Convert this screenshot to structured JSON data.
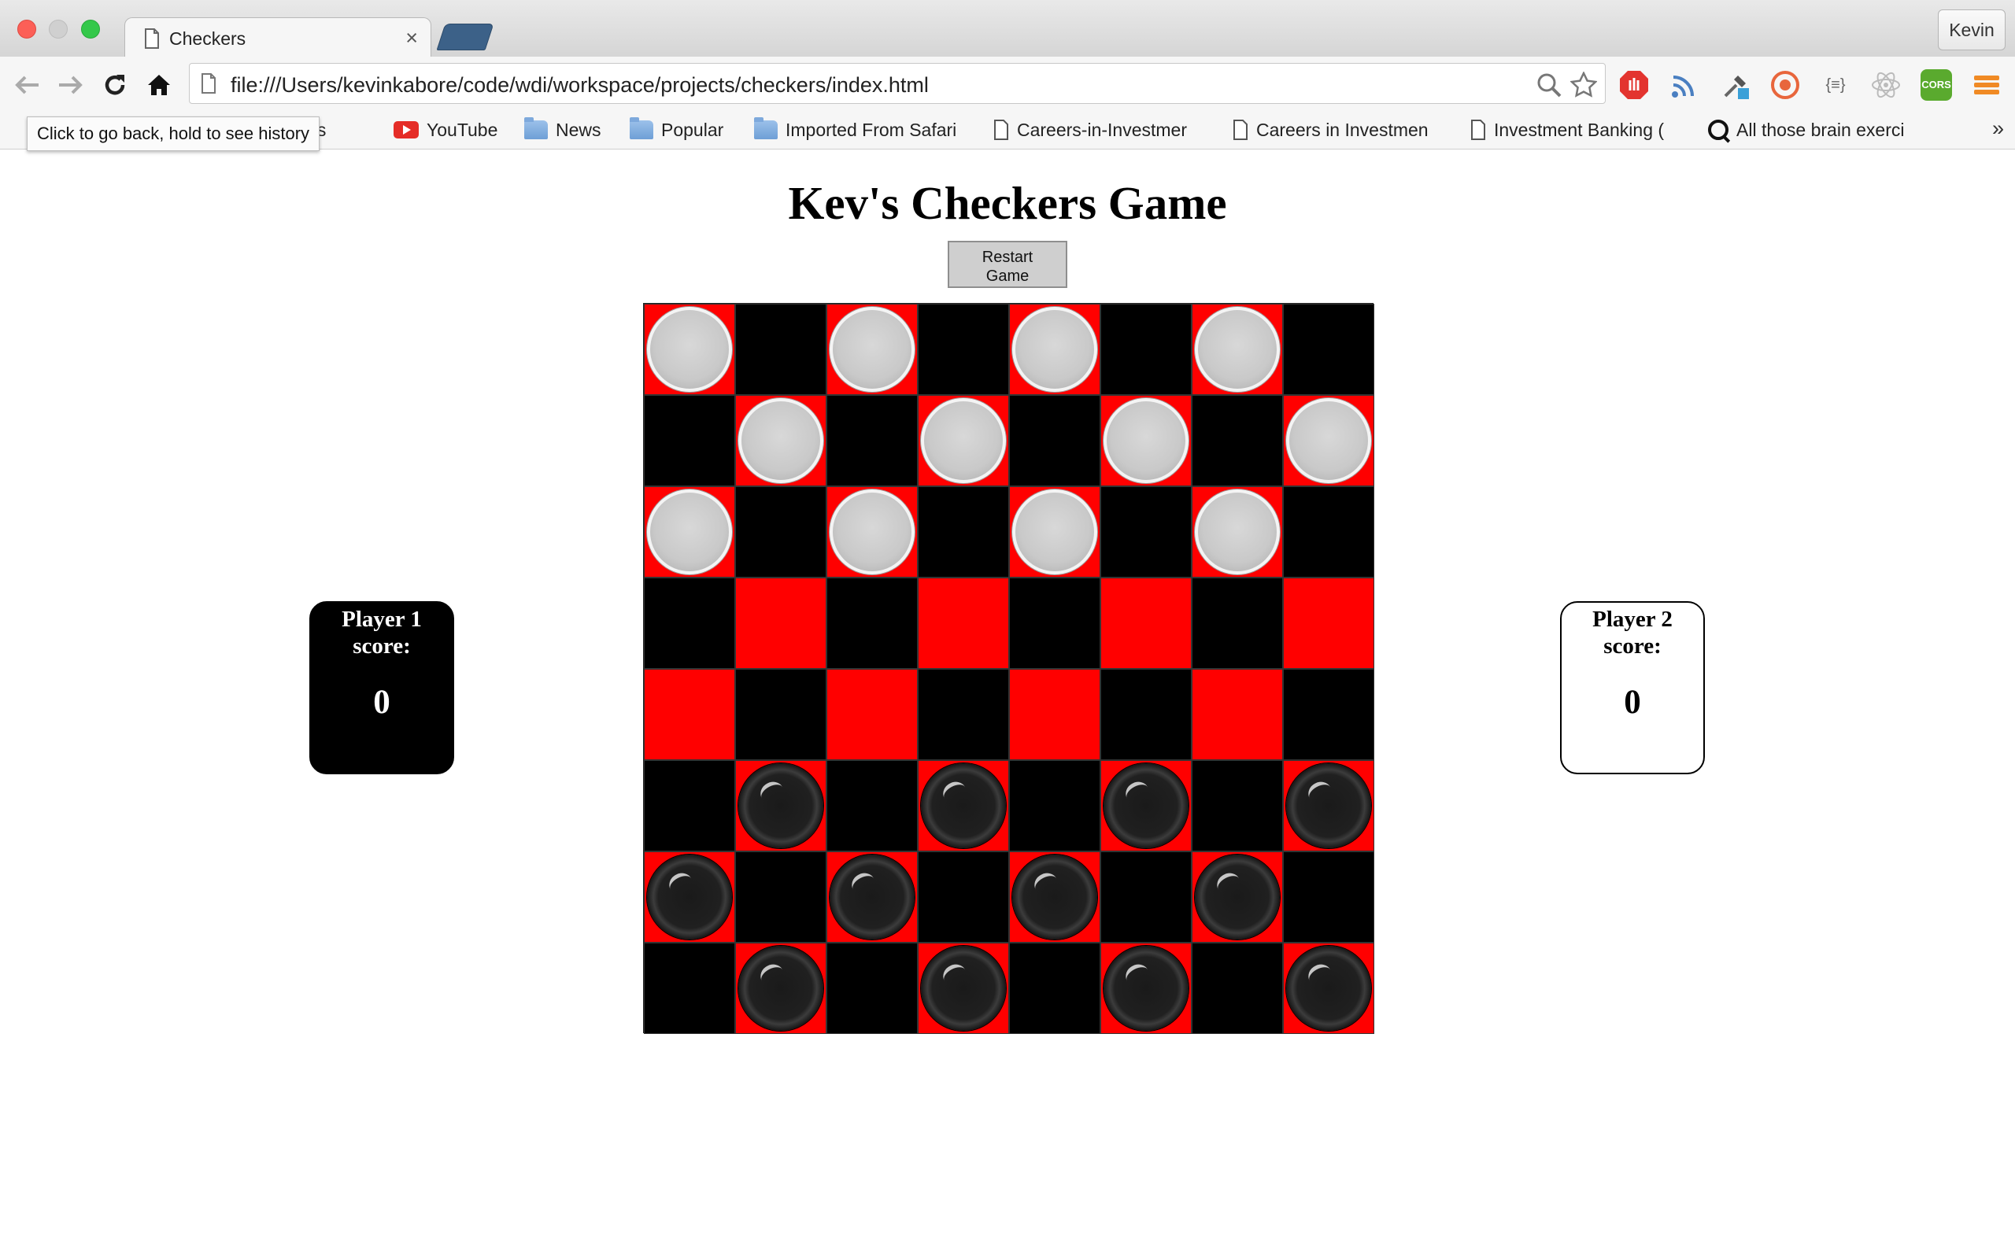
{
  "browser": {
    "tab_title": "Checkers",
    "tab_close": "×",
    "profile": "Kevin",
    "url": "file:///Users/kevinkabore/code/wdi/workspace/projects/checkers/index.html",
    "tooltip": "Click to go back, hold to see history",
    "bookmarks": {
      "apps": "Apps",
      "youtube": "YouTube",
      "news": "News",
      "popular": "Popular",
      "imported": "Imported From Safari",
      "careers1": "Careers-in-Investmer",
      "careers2": "Careers in Investmen",
      "banking": "Investment Banking (",
      "brain": "All those brain exerci"
    },
    "more": "»",
    "extension_labels": {
      "json": "{≡}",
      "cors": "CORS"
    }
  },
  "game": {
    "title": "Kev's Checkers Game",
    "restart_line1": "Restart",
    "restart_line2": "Game",
    "colors": {
      "red_square": "#ff0000",
      "black_square": "#000000"
    },
    "board": [
      [
        "L",
        "",
        "L",
        "",
        "L",
        "",
        "L",
        ""
      ],
      [
        "",
        "L",
        "",
        "L",
        "",
        "L",
        "",
        "L"
      ],
      [
        "L",
        "",
        "L",
        "",
        "L",
        "",
        "L",
        ""
      ],
      [
        "",
        "",
        "",
        "",
        "",
        "",
        "",
        ""
      ],
      [
        "",
        "",
        "",
        "",
        "",
        "",
        "",
        ""
      ],
      [
        "",
        "D",
        "",
        "D",
        "",
        "D",
        "",
        "D"
      ],
      [
        "D",
        "",
        "D",
        "",
        "D",
        "",
        "D",
        ""
      ],
      [
        "",
        "D",
        "",
        "D",
        "",
        "D",
        "",
        "D"
      ]
    ],
    "player1": {
      "label": "Player 1 score:",
      "score": "0"
    },
    "player2": {
      "label": "Player 2 score:",
      "score": "0"
    }
  }
}
